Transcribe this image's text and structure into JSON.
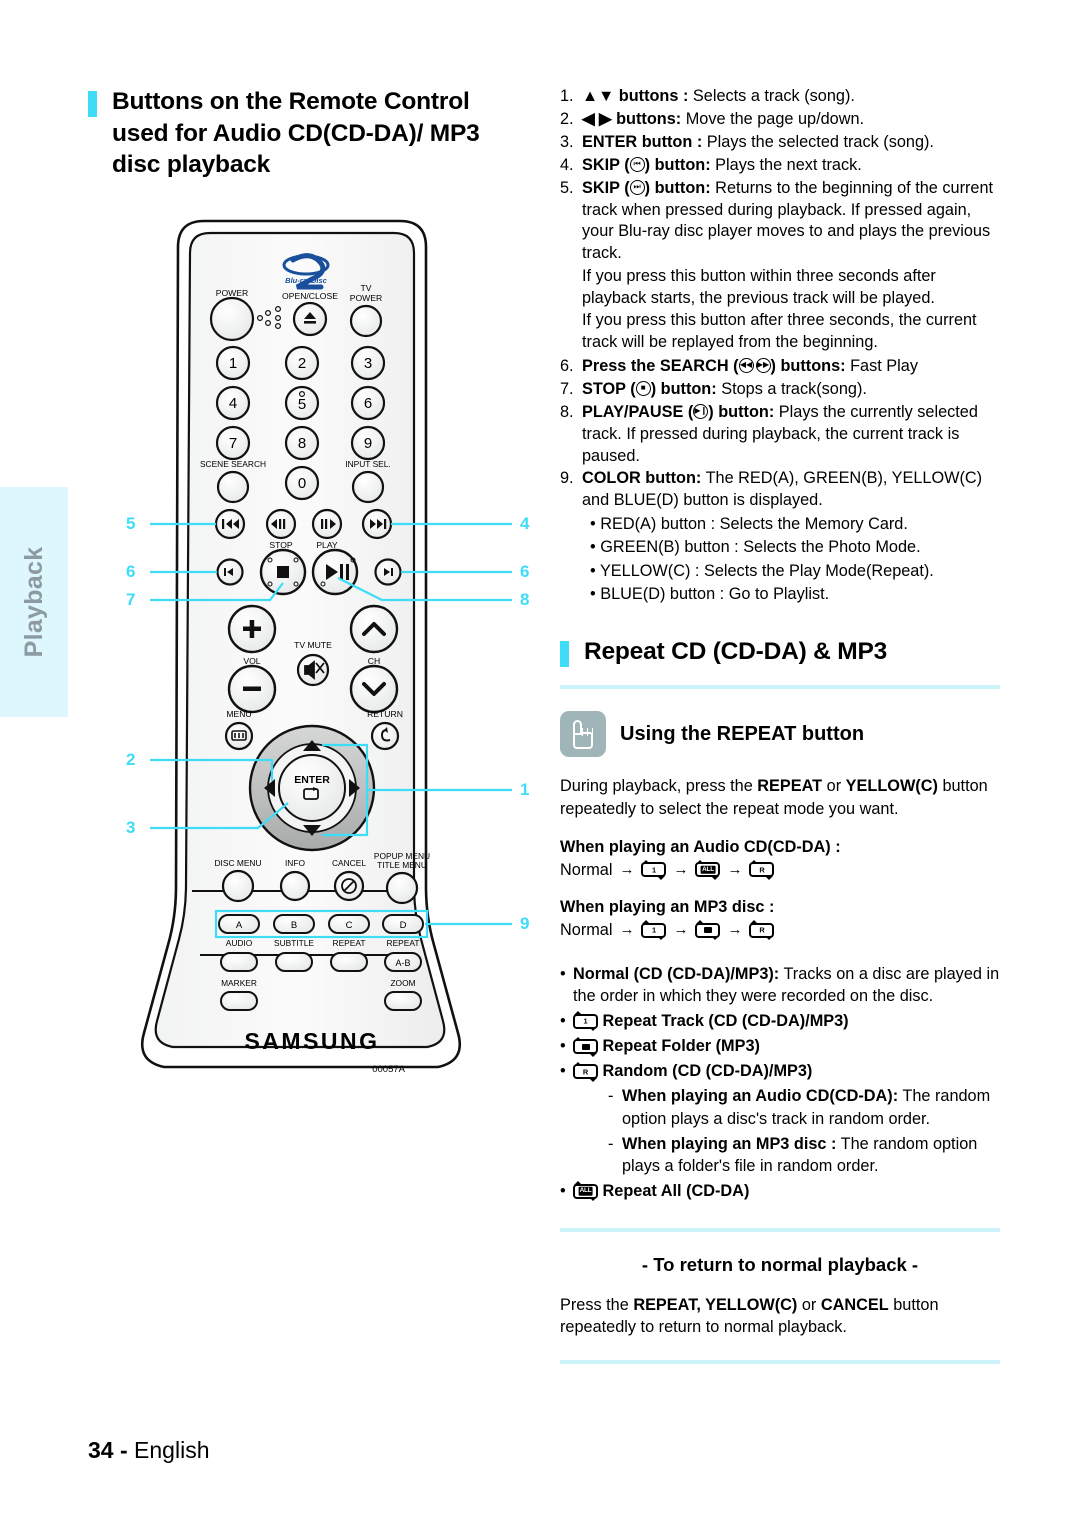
{
  "sidebar": {
    "tab_label": "Playback"
  },
  "footer": {
    "page_number": "34",
    "separator": " - ",
    "language": "English"
  },
  "left_column": {
    "heading": "Buttons on the Remote Control used for Audio CD(CD-DA)/ MP3 disc playback"
  },
  "remote": {
    "brand": "SAMSUNG",
    "model_code": "00057A",
    "disc_logo": "Blu-rayDisc",
    "labels": {
      "power": "POWER",
      "open_close": "OPEN/CLOSE",
      "tv_power": "TV POWER",
      "scene_search": "SCENE SEARCH",
      "input_sel": "INPUT SEL.",
      "stop": "STOP",
      "play": "PLAY",
      "vol": "VOL",
      "tv_mute": "TV MUTE",
      "ch": "CH",
      "menu": "MENU",
      "return": "RETURN",
      "enter": "ENTER",
      "disc_menu": "DISC MENU",
      "info": "INFO",
      "cancel": "CANCEL",
      "popup_title_menu": "POPUP MENU TITLE MENU",
      "audio": "AUDIO",
      "subtitle": "SUBTITLE",
      "repeat": "REPEAT",
      "repeat_ab": "REPEAT",
      "ab": "A-B",
      "marker": "MARKER",
      "zoom": "ZOOM"
    },
    "numeric_keys": [
      "1",
      "2",
      "3",
      "4",
      "5",
      "6",
      "7",
      "8",
      "9",
      "0"
    ],
    "color_keys": [
      "A",
      "B",
      "C",
      "D"
    ],
    "callouts_left": [
      "5",
      "6",
      "7",
      "2",
      "3"
    ],
    "callouts_right": [
      "4",
      "6",
      "8",
      "1",
      "9"
    ],
    "callout_color": "#3edcf7"
  },
  "instructions": {
    "items": [
      {
        "num": "1.",
        "bold": "▲▼ buttons :",
        "rest": " Selects a track (song)."
      },
      {
        "num": "2.",
        "bold": "◀ ▶ buttons:",
        "rest": " Move the page up/down."
      },
      {
        "num": "3.",
        "bold": "ENTER button :",
        "rest": " Plays the selected track (song)."
      },
      {
        "num": "4.",
        "bold_pre": "SKIP (",
        "bold_post": ") button:",
        "rest": " Plays the next track."
      },
      {
        "num": "5.",
        "bold_pre": "SKIP (",
        "bold_post": ") button:",
        "rest": " Returns to the beginning of the current track when pressed during playback. If pressed again, your Blu-ray disc player moves to and plays the previous track.",
        "cont1": "If you press this button within three seconds after playback starts, the previous track will be played.",
        "cont2": "If you press this button after three seconds, the current track will be replayed from the beginning."
      },
      {
        "num": "6.",
        "bold_pre": "Press the SEARCH (",
        "bold_post": ") buttons:",
        "rest": " Fast Play"
      },
      {
        "num": "7.",
        "bold_pre": "STOP (",
        "bold_post": ") button:",
        "rest": " Stops a track(song)."
      },
      {
        "num": "8.",
        "bold_pre": "PLAY/PAUSE (",
        "bold_post": ") button:",
        "rest": " Plays the currently selected track. If pressed during playback, the current track is paused."
      },
      {
        "num": "9.",
        "bold": "COLOR button:",
        "rest": " The RED(A), GREEN(B), YELLOW(C) and BLUE(D) button is displayed."
      }
    ],
    "color_bullets": [
      "RED(A) button : Selects the Memory Card.",
      "GREEN(B) button : Selects the Photo Mode.",
      "YELLOW(C) : Selects the Play Mode(Repeat).",
      "BLUE(D) button : Go to Playlist."
    ]
  },
  "repeat_section": {
    "heading": "Repeat CD (CD-DA) & MP3",
    "subheading": "Using the REPEAT button",
    "intro": {
      "pre": "During playback, press the ",
      "b1": "REPEAT",
      "mid": " or ",
      "b2": "YELLOW(C)",
      "post": " button repeatedly to select the repeat mode you want."
    },
    "cd_label": "When playing an Audio CD(CD-DA) :",
    "cd_sequence": {
      "start": "Normal",
      "icons": [
        "1",
        "ALL",
        "R"
      ]
    },
    "mp3_label": "When playing an MP3 disc :",
    "mp3_sequence": {
      "start": "Normal",
      "icons": [
        "1",
        "FOLDER",
        "R"
      ]
    },
    "bullets": [
      {
        "icon": null,
        "bold": "Normal (CD (CD-DA)/MP3):",
        "rest": " Tracks on a disc are played in the order in which they were recorded on the disc."
      },
      {
        "icon": "1",
        "bold": "Repeat Track (CD (CD-DA)/MP3)",
        "rest": ""
      },
      {
        "icon": "FOLDER",
        "bold": "Repeat Folder (MP3)",
        "rest": ""
      },
      {
        "icon": "R",
        "bold": "Random (CD (CD-DA)/MP3)",
        "rest": ""
      }
    ],
    "sub_items": [
      {
        "dash": "-",
        "bold": "When playing an Audio CD(CD-DA):",
        "rest": " The random option plays a disc's track in random order."
      },
      {
        "dash": "-",
        "bold": "When playing an MP3 disc :",
        "rest": " The random option plays a folder's file in random order."
      }
    ],
    "last_bullet": {
      "icon": "ALL",
      "bold": "Repeat All (CD-DA)",
      "rest": ""
    },
    "return_heading": "- To return to normal playback -",
    "return_body": {
      "pre": "Press the ",
      "b1": "REPEAT, YELLOW(C)",
      "mid": " or ",
      "b2": "CANCEL",
      "post": " button repeatedly to return to normal playback."
    }
  },
  "colors": {
    "accent_cyan": "#3edcf7",
    "rule_cyan": "#cdf4fa",
    "tab_bg": "#ddf7fc",
    "icon_bg": "#9fb5b7"
  }
}
